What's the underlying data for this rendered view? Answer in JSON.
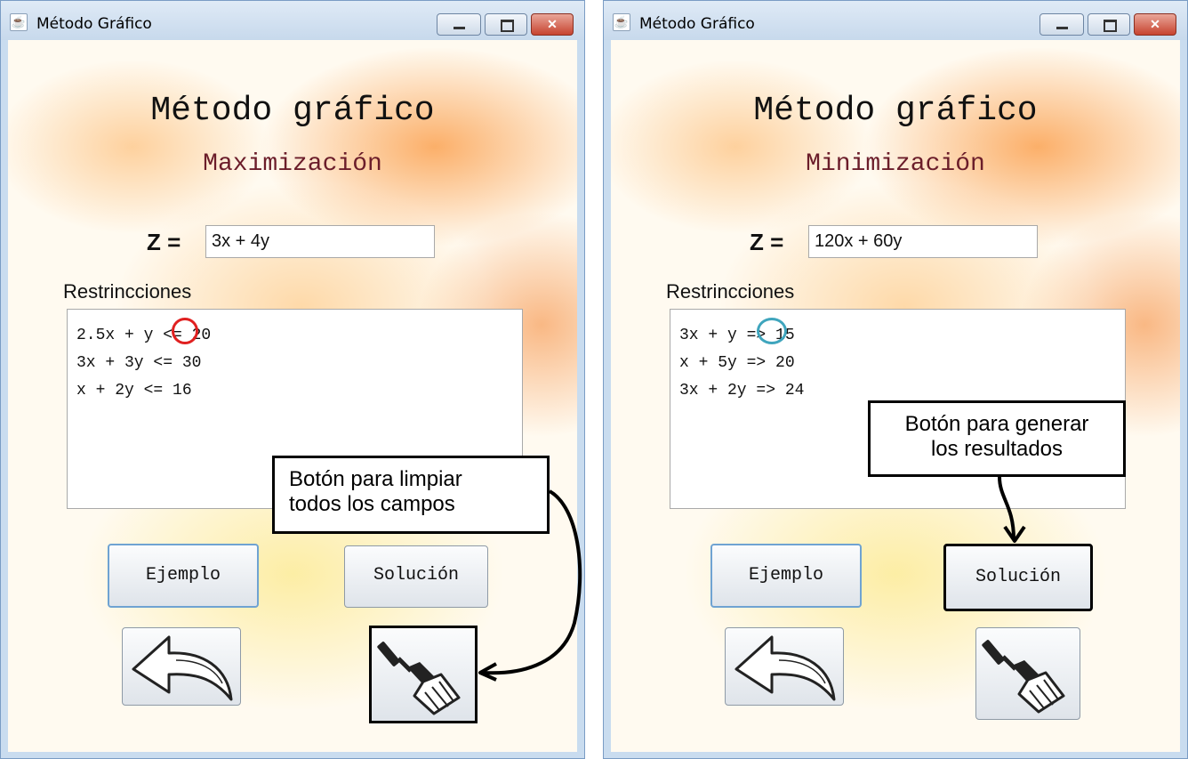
{
  "left_window": {
    "title": "Método Gráfico",
    "heading": "Método gráfico",
    "subheading": "Maximización",
    "z_label": "Z =",
    "z_value": "3x + 4y",
    "restrictions_label": "Restrincciones",
    "restrictions": [
      "2.5x + y <= 20",
      "3x + 3y <= 30",
      "x + 2y <= 16"
    ],
    "example_button": "Ejemplo",
    "solution_button": "Solución",
    "highlight_color": "#e02020"
  },
  "right_window": {
    "title": "Método Gráfico",
    "heading": "Método gráfico",
    "subheading": "Minimización",
    "z_label": "Z =",
    "z_value": "120x + 60y",
    "restrictions_label": "Restrincciones",
    "restrictions": [
      "3x + y => 15",
      "x + 5y => 20",
      "3x + 2y => 24"
    ],
    "example_button": "Ejemplo",
    "solution_button": "Solución",
    "highlight_color": "#3fa5bd"
  },
  "callouts": {
    "clear_line1": "Botón para limpiar",
    "clear_line2": "todos los campos",
    "generate_line1": "Botón para generar",
    "generate_line2": "los resultados"
  },
  "icons": {
    "back": "back-arrow-icon",
    "clear": "broom-icon",
    "app": "java-icon"
  }
}
